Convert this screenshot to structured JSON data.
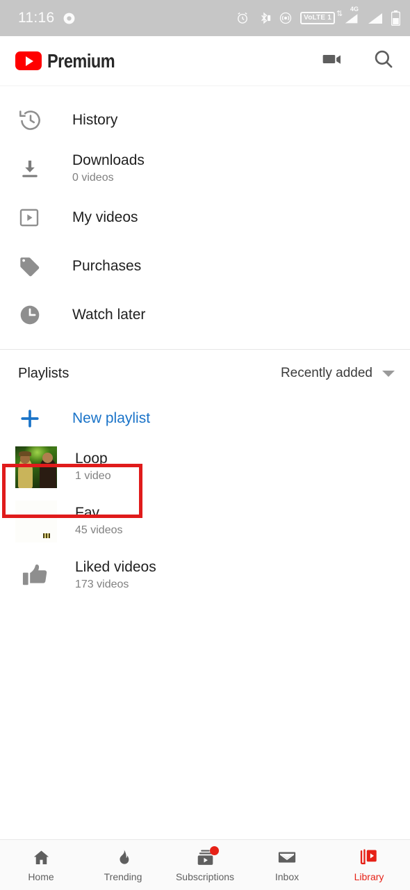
{
  "status_bar": {
    "time": "11:16",
    "icons": [
      "record-dot-icon",
      "alarm-icon",
      "bluetooth-icon",
      "hotspot-icon",
      "volte-badge",
      "signal-4g-icon",
      "signal-icon",
      "battery-icon"
    ],
    "volte_label": "VoLTE 1",
    "network_label": "4G",
    "background": "#c6c6c6"
  },
  "header": {
    "brand": "Premium",
    "logo_color": "#ff0000",
    "actions": [
      {
        "name": "upload-video-button",
        "icon": "video-camera-icon"
      },
      {
        "name": "search-button",
        "icon": "search-icon"
      }
    ]
  },
  "library": {
    "items": [
      {
        "label": "History",
        "subtitle": "",
        "icon": "history-icon"
      },
      {
        "label": "Downloads",
        "subtitle": "0 videos",
        "icon": "download-icon"
      },
      {
        "label": "My videos",
        "subtitle": "",
        "icon": "my-videos-icon"
      },
      {
        "label": "Purchases",
        "subtitle": "",
        "icon": "tag-icon"
      },
      {
        "label": "Watch later",
        "subtitle": "",
        "icon": "clock-icon"
      }
    ]
  },
  "playlists": {
    "section_title": "Playlists",
    "sort_label": "Recently added",
    "sort_icon": "chevron-down-icon",
    "new_playlist_label": "New playlist",
    "new_playlist_color": "#1a73c8",
    "items": [
      {
        "title": "Loop",
        "count": "1 video",
        "thumb": "video-thumbnail",
        "highlighted": true
      },
      {
        "title": "Fav",
        "count": "45 videos",
        "thumb": "video-thumbnail",
        "highlighted": false
      },
      {
        "title": "Liked videos",
        "count": "173 videos",
        "thumb": "thumbs-up-icon",
        "highlighted": false
      }
    ],
    "highlight_color": "#e01b1b"
  },
  "bottom_nav": {
    "active": "Library",
    "active_color": "#e62117",
    "items": [
      {
        "label": "Home",
        "icon": "home-icon",
        "badge": false
      },
      {
        "label": "Trending",
        "icon": "flame-icon",
        "badge": false
      },
      {
        "label": "Subscriptions",
        "icon": "subscriptions-icon",
        "badge": true
      },
      {
        "label": "Inbox",
        "icon": "envelope-icon",
        "badge": false
      },
      {
        "label": "Library",
        "icon": "library-icon",
        "badge": false
      }
    ]
  }
}
